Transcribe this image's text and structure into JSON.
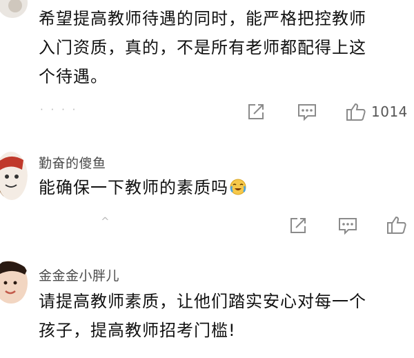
{
  "comments": [
    {
      "text_line1": "希望提高教师待遇的同时，能严格把控教师",
      "text_line2": "入门资质，真的，不是所有老师都配得上这",
      "text_line3": "个待遇。",
      "meta": "·  ·  ·   ·",
      "like_count": "1014",
      "icons": [
        "share-icon",
        "comment-icon",
        "like-icon"
      ]
    },
    {
      "username": "勤奋的傻鱼",
      "text": "能确保一下教师的素质吗",
      "emoji": "crying-laughing-emoji",
      "meta": "^",
      "icons": [
        "share-icon",
        "comment-icon",
        "like-icon"
      ]
    },
    {
      "username": "金金金小胖儿",
      "text_line1": "请提高教师素质，让他们踏实安心对每一个",
      "text_line2": "孩子，提高教师招考门槛!"
    }
  ],
  "colors": {
    "text": "#111111",
    "username": "#4a4a4a",
    "icon": "#8a8a8a",
    "meta": "#b9b9b9"
  }
}
